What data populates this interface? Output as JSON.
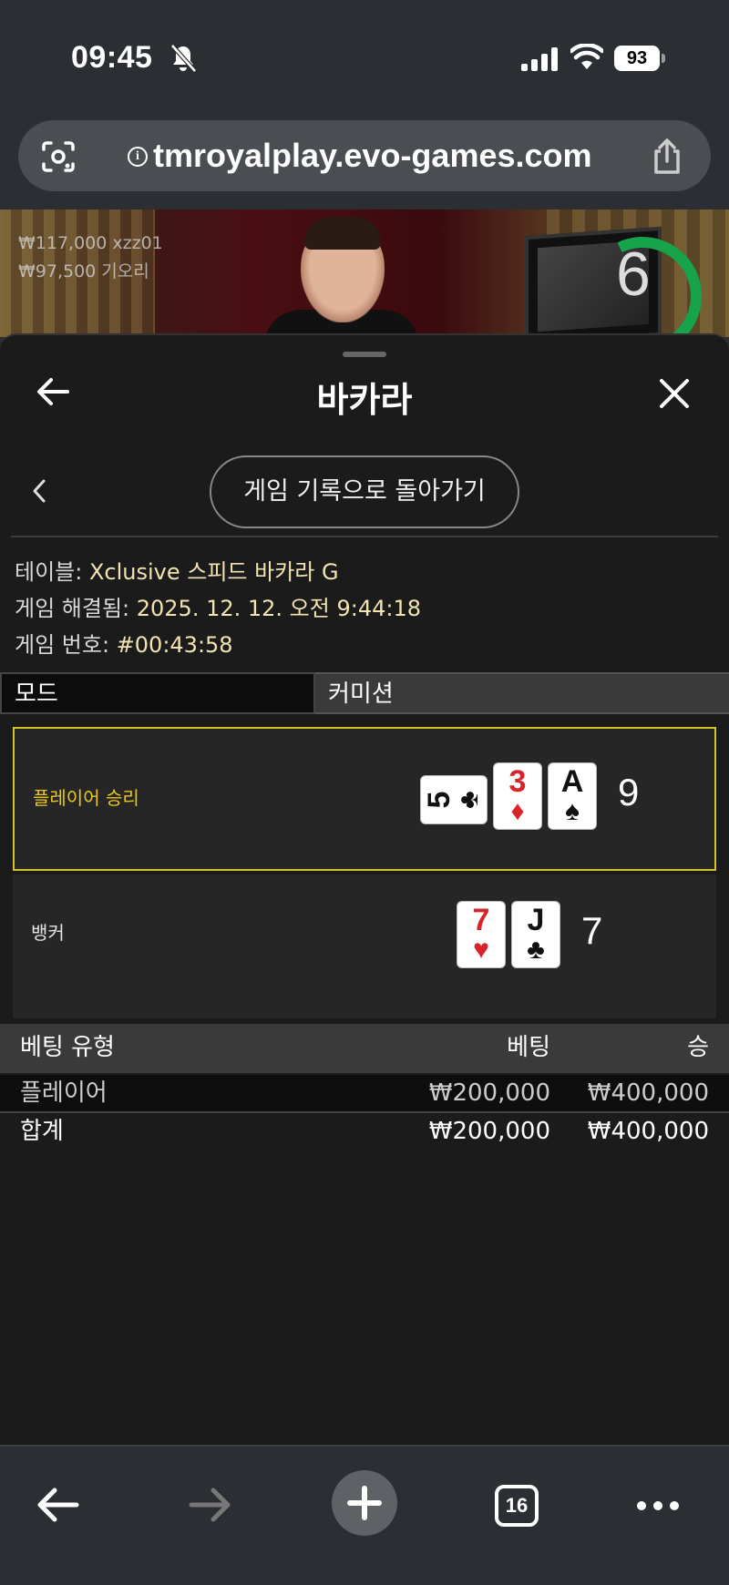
{
  "status_bar": {
    "time": "09:45",
    "battery": "93"
  },
  "browser": {
    "url": "tmroyalplay.evo-games.com",
    "tab_count": "16"
  },
  "video": {
    "timer": "6",
    "bet_feed": [
      {
        "text": "₩117,000  xzz01"
      },
      {
        "text": "₩97,500  기오리"
      }
    ]
  },
  "sheet": {
    "title": "바카라",
    "history_button": "게임 기록으로 돌아가기",
    "info": {
      "table_label": "테이블: ",
      "table_value": "Xclusive 스피드 바카라 G",
      "resolved_label": "게임 해결됨: ",
      "resolved_value": "2025. 12. 12. 오전 9:44:18",
      "number_label": "게임 번호: ",
      "number_value": "#00:43:58"
    },
    "tabs": {
      "mode": "모드",
      "commission": "커미션"
    },
    "results": {
      "player": {
        "label": "플레이어 승리",
        "score": "9",
        "cards": [
          {
            "rank": "5",
            "suit": "♣",
            "color": "#111111",
            "orientation": "sideways"
          },
          {
            "rank": "3",
            "suit": "♦",
            "color": "#d8232a",
            "orientation": "upright"
          },
          {
            "rank": "A",
            "suit": "♠",
            "color": "#111111",
            "orientation": "upright"
          }
        ]
      },
      "banker": {
        "label": "뱅커",
        "score": "7",
        "cards": [
          {
            "rank": "7",
            "suit": "♥",
            "color": "#d8232a",
            "orientation": "upright"
          },
          {
            "rank": "J",
            "suit": "♣",
            "color": "#111111",
            "orientation": "upright"
          }
        ]
      }
    },
    "bets": {
      "headers": {
        "type": "베팅 유형",
        "bet": "베팅",
        "win": "승"
      },
      "rows": [
        {
          "type": "플레이어",
          "bet": "₩200,000",
          "win": "₩400,000"
        }
      ],
      "total": {
        "type": "합계",
        "bet": "₩200,000",
        "win": "₩400,000"
      }
    }
  },
  "colors": {
    "winner_accent": "#e8c81e",
    "timer_ring": "#16a34a",
    "sheet_bg": "#1b1b1b"
  }
}
